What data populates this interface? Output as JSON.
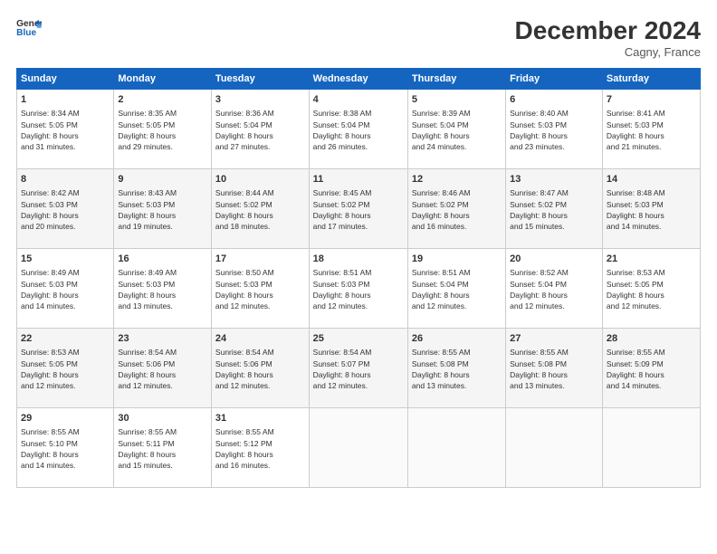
{
  "logo": {
    "line1": "General",
    "line2": "Blue"
  },
  "title": "December 2024",
  "location": "Cagny, France",
  "days_header": [
    "Sunday",
    "Monday",
    "Tuesday",
    "Wednesday",
    "Thursday",
    "Friday",
    "Saturday"
  ],
  "weeks": [
    [
      {
        "day": "1",
        "info": "Sunrise: 8:34 AM\nSunset: 5:05 PM\nDaylight: 8 hours\nand 31 minutes."
      },
      {
        "day": "2",
        "info": "Sunrise: 8:35 AM\nSunset: 5:05 PM\nDaylight: 8 hours\nand 29 minutes."
      },
      {
        "day": "3",
        "info": "Sunrise: 8:36 AM\nSunset: 5:04 PM\nDaylight: 8 hours\nand 27 minutes."
      },
      {
        "day": "4",
        "info": "Sunrise: 8:38 AM\nSunset: 5:04 PM\nDaylight: 8 hours\nand 26 minutes."
      },
      {
        "day": "5",
        "info": "Sunrise: 8:39 AM\nSunset: 5:04 PM\nDaylight: 8 hours\nand 24 minutes."
      },
      {
        "day": "6",
        "info": "Sunrise: 8:40 AM\nSunset: 5:03 PM\nDaylight: 8 hours\nand 23 minutes."
      },
      {
        "day": "7",
        "info": "Sunrise: 8:41 AM\nSunset: 5:03 PM\nDaylight: 8 hours\nand 21 minutes."
      }
    ],
    [
      {
        "day": "8",
        "info": "Sunrise: 8:42 AM\nSunset: 5:03 PM\nDaylight: 8 hours\nand 20 minutes."
      },
      {
        "day": "9",
        "info": "Sunrise: 8:43 AM\nSunset: 5:03 PM\nDaylight: 8 hours\nand 19 minutes."
      },
      {
        "day": "10",
        "info": "Sunrise: 8:44 AM\nSunset: 5:02 PM\nDaylight: 8 hours\nand 18 minutes."
      },
      {
        "day": "11",
        "info": "Sunrise: 8:45 AM\nSunset: 5:02 PM\nDaylight: 8 hours\nand 17 minutes."
      },
      {
        "day": "12",
        "info": "Sunrise: 8:46 AM\nSunset: 5:02 PM\nDaylight: 8 hours\nand 16 minutes."
      },
      {
        "day": "13",
        "info": "Sunrise: 8:47 AM\nSunset: 5:02 PM\nDaylight: 8 hours\nand 15 minutes."
      },
      {
        "day": "14",
        "info": "Sunrise: 8:48 AM\nSunset: 5:03 PM\nDaylight: 8 hours\nand 14 minutes."
      }
    ],
    [
      {
        "day": "15",
        "info": "Sunrise: 8:49 AM\nSunset: 5:03 PM\nDaylight: 8 hours\nand 14 minutes."
      },
      {
        "day": "16",
        "info": "Sunrise: 8:49 AM\nSunset: 5:03 PM\nDaylight: 8 hours\nand 13 minutes."
      },
      {
        "day": "17",
        "info": "Sunrise: 8:50 AM\nSunset: 5:03 PM\nDaylight: 8 hours\nand 12 minutes."
      },
      {
        "day": "18",
        "info": "Sunrise: 8:51 AM\nSunset: 5:03 PM\nDaylight: 8 hours\nand 12 minutes."
      },
      {
        "day": "19",
        "info": "Sunrise: 8:51 AM\nSunset: 5:04 PM\nDaylight: 8 hours\nand 12 minutes."
      },
      {
        "day": "20",
        "info": "Sunrise: 8:52 AM\nSunset: 5:04 PM\nDaylight: 8 hours\nand 12 minutes."
      },
      {
        "day": "21",
        "info": "Sunrise: 8:53 AM\nSunset: 5:05 PM\nDaylight: 8 hours\nand 12 minutes."
      }
    ],
    [
      {
        "day": "22",
        "info": "Sunrise: 8:53 AM\nSunset: 5:05 PM\nDaylight: 8 hours\nand 12 minutes."
      },
      {
        "day": "23",
        "info": "Sunrise: 8:54 AM\nSunset: 5:06 PM\nDaylight: 8 hours\nand 12 minutes."
      },
      {
        "day": "24",
        "info": "Sunrise: 8:54 AM\nSunset: 5:06 PM\nDaylight: 8 hours\nand 12 minutes."
      },
      {
        "day": "25",
        "info": "Sunrise: 8:54 AM\nSunset: 5:07 PM\nDaylight: 8 hours\nand 12 minutes."
      },
      {
        "day": "26",
        "info": "Sunrise: 8:55 AM\nSunset: 5:08 PM\nDaylight: 8 hours\nand 13 minutes."
      },
      {
        "day": "27",
        "info": "Sunrise: 8:55 AM\nSunset: 5:08 PM\nDaylight: 8 hours\nand 13 minutes."
      },
      {
        "day": "28",
        "info": "Sunrise: 8:55 AM\nSunset: 5:09 PM\nDaylight: 8 hours\nand 14 minutes."
      }
    ],
    [
      {
        "day": "29",
        "info": "Sunrise: 8:55 AM\nSunset: 5:10 PM\nDaylight: 8 hours\nand 14 minutes."
      },
      {
        "day": "30",
        "info": "Sunrise: 8:55 AM\nSunset: 5:11 PM\nDaylight: 8 hours\nand 15 minutes."
      },
      {
        "day": "31",
        "info": "Sunrise: 8:55 AM\nSunset: 5:12 PM\nDaylight: 8 hours\nand 16 minutes."
      },
      {
        "day": "",
        "info": ""
      },
      {
        "day": "",
        "info": ""
      },
      {
        "day": "",
        "info": ""
      },
      {
        "day": "",
        "info": ""
      }
    ]
  ]
}
